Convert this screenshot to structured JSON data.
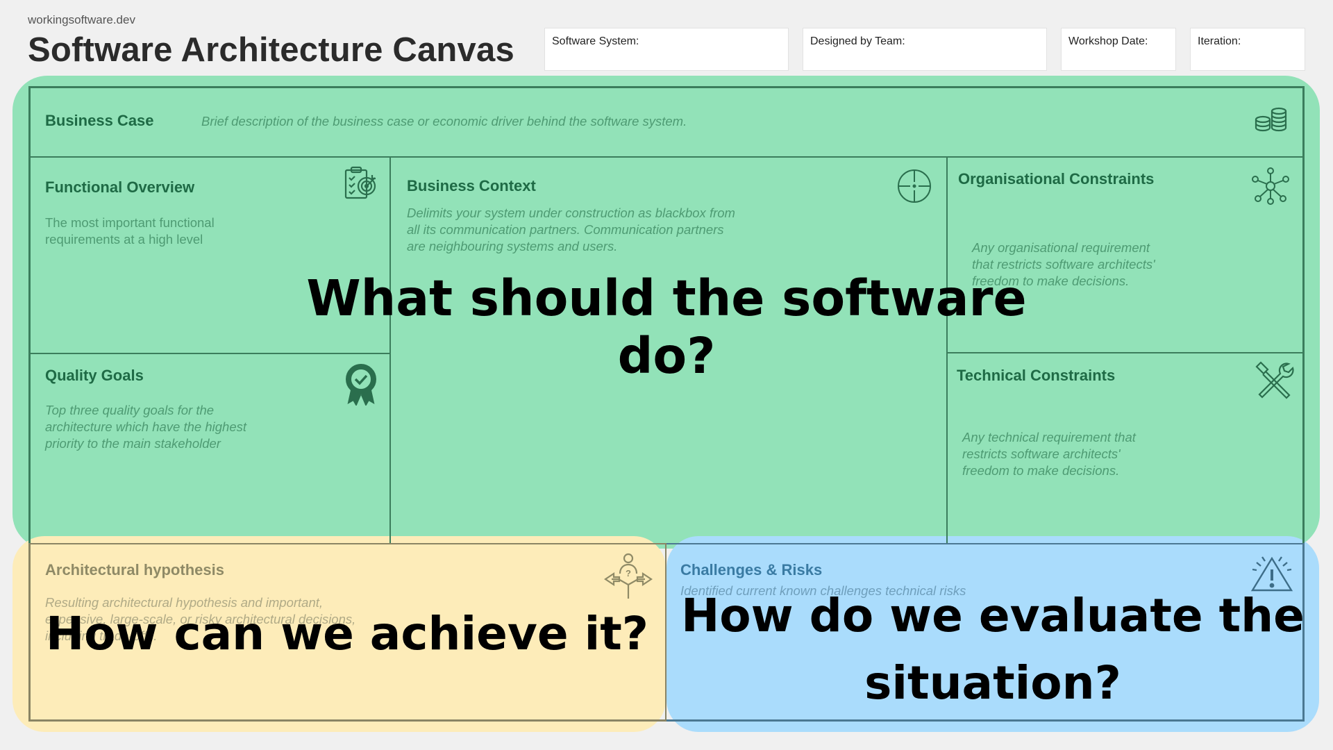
{
  "header": {
    "site": "workingsoftware.dev",
    "title": "Software Architecture Canvas",
    "fields": [
      {
        "label": "Software System:"
      },
      {
        "label": "Designed by Team:"
      },
      {
        "label": "Workshop Date:"
      },
      {
        "label": "Iteration:"
      }
    ]
  },
  "sections": {
    "business_case": {
      "title": "Business Case",
      "desc": "Brief description of the business case or economic driver behind the software system.",
      "icon": "coins-icon"
    },
    "functional_overview": {
      "title": "Functional Overview",
      "desc_lines": [
        "The most important functional",
        "requirements at a high level"
      ],
      "icon": "clipboard-target-icon"
    },
    "business_context": {
      "title": "Business Context",
      "desc_lines": [
        "Delimits your system under construction as blackbox from",
        "all its communication partners. Communication partners",
        "are neighbouring systems and users."
      ],
      "icon": "crosshair-icon"
    },
    "organisational_constraints": {
      "title": "Organisational Constraints",
      "desc_lines": [
        "Any organisational requirement",
        "that restricts software architects'",
        "freedom to make decisions."
      ],
      "icon": "network-icon"
    },
    "quality_goals": {
      "title": "Quality Goals",
      "desc_lines": [
        "Top three quality goals for the",
        "architecture which have the  highest",
        "priority to the main stakeholder"
      ],
      "icon": "badge-check-icon"
    },
    "technical_constraints": {
      "title": "Technical Constraints",
      "desc_lines": [
        "Any technical requirement that",
        "restricts software architects'",
        "freedom to make decisions."
      ],
      "icon": "tools-icon"
    },
    "architectural_hypothesis": {
      "title": "Architectural hypothesis",
      "desc_lines": [
        "Resulting architectural hypothesis and important,",
        "expensive, large-scale, or risky architectural decisions,",
        "including trade-offs."
      ],
      "icon": "person-decision-icon"
    },
    "challenges_risks": {
      "title": "Challenges & Risks",
      "desc": "Identified current known challenges technical risks",
      "icon": "warning-icon"
    }
  },
  "overlays": {
    "green_question": "What should the software do?",
    "yellow_question": "How can we achieve it?",
    "blue_question_lines": [
      "How do we evaluate the",
      "situation?"
    ]
  },
  "colors": {
    "green_region": "#92e2b8",
    "yellow_region": "#fdecb9",
    "blue_region": "#aadcfc",
    "green_text": "#1e6a45",
    "green_line": "#3b7d5c"
  }
}
